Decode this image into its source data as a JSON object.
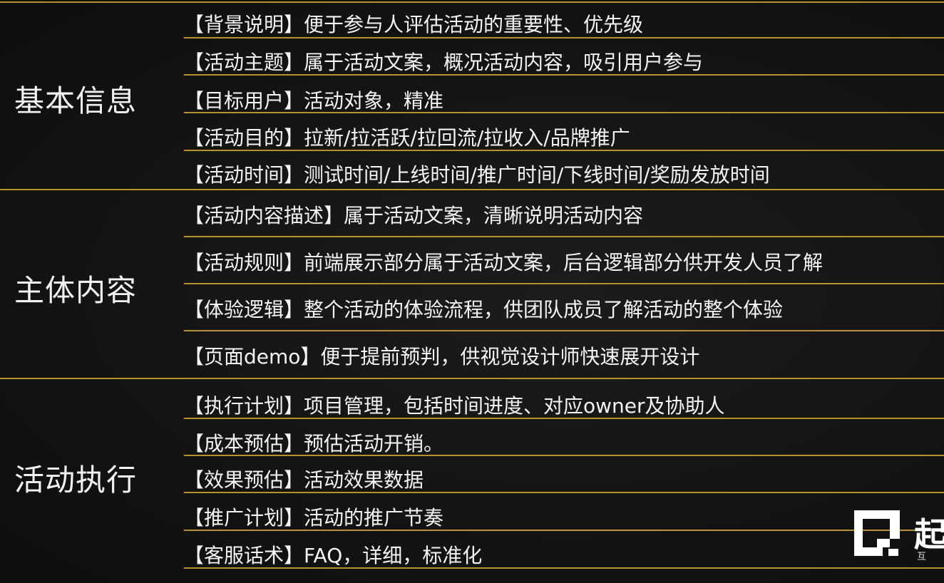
{
  "sections": [
    {
      "title": "基本信息",
      "items": [
        "【背景说明】便于参与人评估活动的重要性、优先级",
        "【活动主题】属于活动文案，概况活动内容，吸引用户参与",
        "【目标用户】活动对象，精准",
        "【活动目的】拉新/拉活跃/拉回流/拉收入/品牌推广",
        "【活动时间】测试时间/上线时间/推广时间/下线时间/奖励发放时间"
      ]
    },
    {
      "title": "主体内容",
      "items": [
        "【活动内容描述】属于活动文案，清晰说明活动内容",
        "【活动规则】前端展示部分属于活动文案，后台逻辑部分供开发人员了解",
        "【体验逻辑】整个活动的体验流程，供团队成员了解活动的整个体验",
        "【页面demo】便于提前预判，供视觉设计师快速展开设计"
      ]
    },
    {
      "title": "活动执行",
      "items": [
        "【执行计划】项目管理，包括时间进度、对应owner及协助人",
        "【成本预估】预估活动开销。",
        "【效果预估】活动效果数据",
        "【推广计划】活动的推广节奏",
        "【客服话术】FAQ，详细，标准化"
      ]
    }
  ],
  "watermark": {
    "char": "起",
    "sub": "互"
  },
  "colors": {
    "background": "#141414",
    "rule": "#b8912f",
    "text": "#f4f4f4"
  }
}
